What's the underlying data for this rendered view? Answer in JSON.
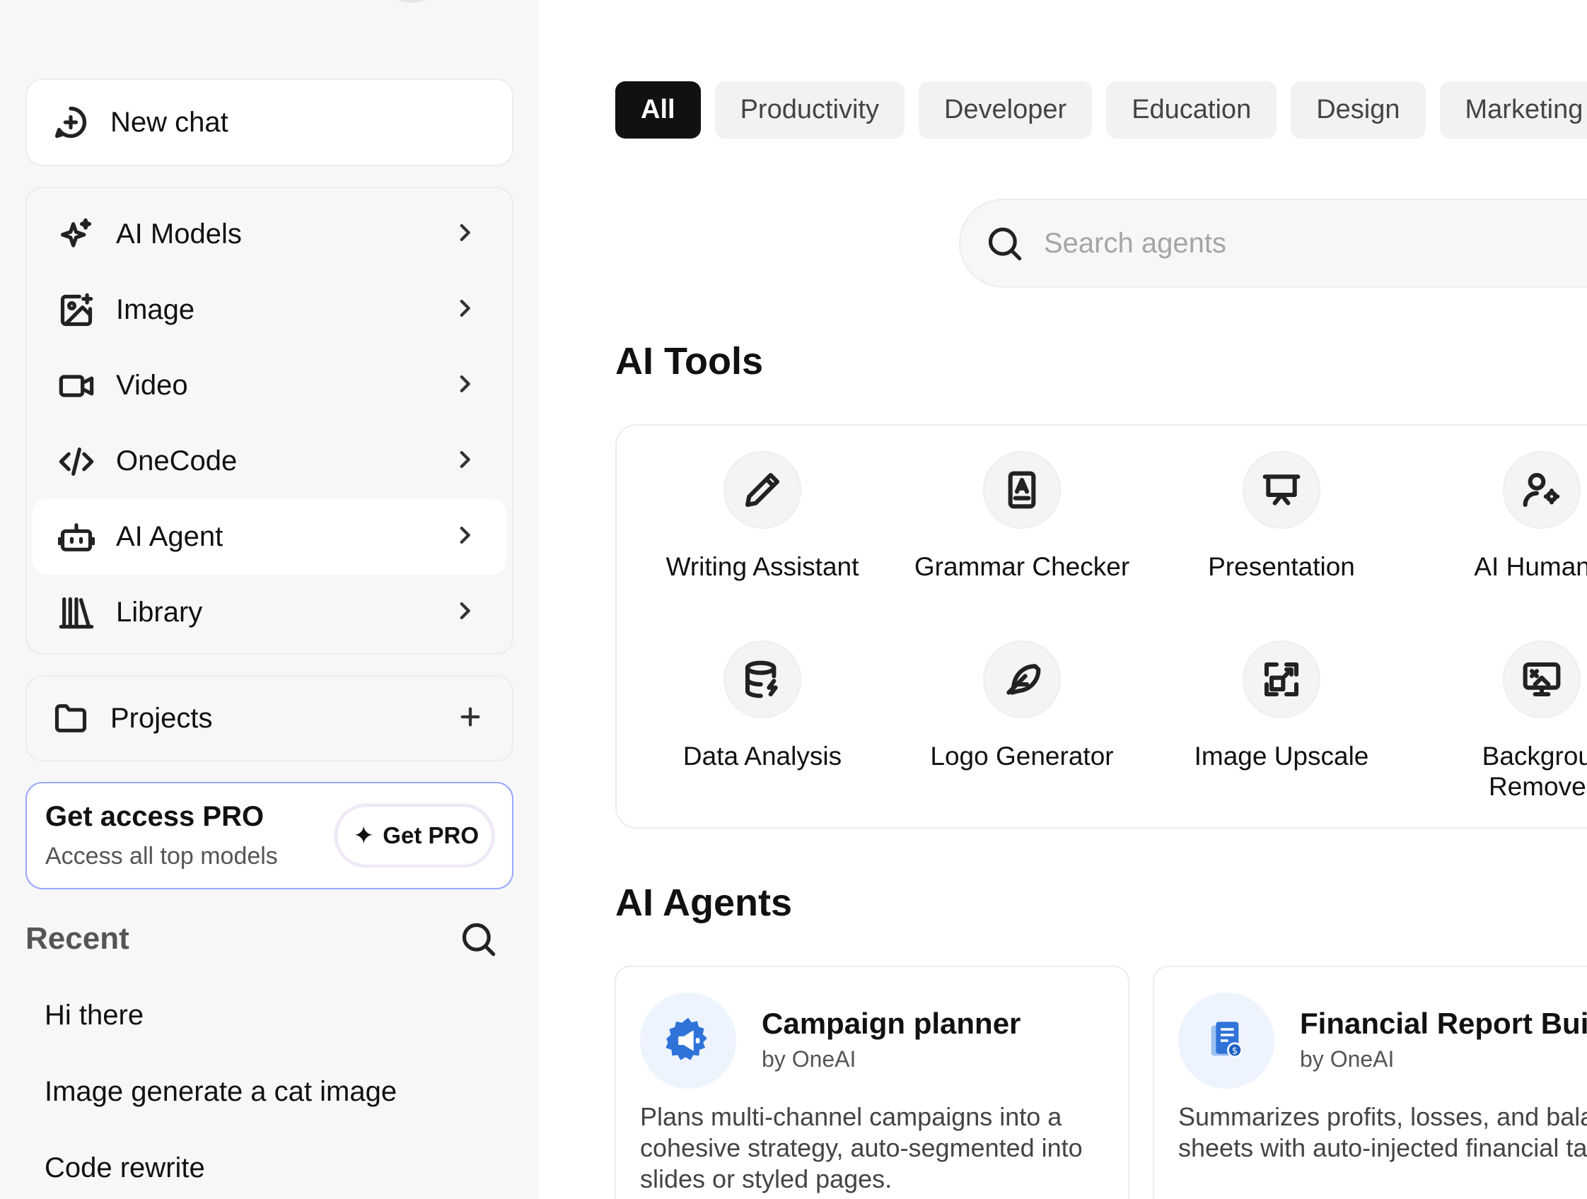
{
  "sidebar": {
    "new_chat": "New chat",
    "nav": [
      {
        "label": "AI Models",
        "icon": "sparkle-icon"
      },
      {
        "label": "Image",
        "icon": "image-icon"
      },
      {
        "label": "Video",
        "icon": "video-icon"
      },
      {
        "label": "OneCode",
        "icon": "code-icon"
      },
      {
        "label": "AI Agent",
        "icon": "robot-icon",
        "active": true
      },
      {
        "label": "Library",
        "icon": "library-icon"
      }
    ],
    "projects": "Projects",
    "pro": {
      "title": "Get access PRO",
      "subtitle": "Access all top models",
      "button": "Get PRO"
    },
    "recent": {
      "title": "Recent",
      "items": [
        "Hi there",
        "Image generate a cat image",
        "Code rewrite"
      ]
    }
  },
  "main": {
    "categories": [
      "All",
      "Productivity",
      "Developer",
      "Education",
      "Design",
      "Marketing"
    ],
    "active_category": "All",
    "search": {
      "placeholder": "Search agents"
    },
    "tools_title": "AI Tools",
    "tools": [
      {
        "label": "Writing Assistant",
        "icon": "pencil-icon"
      },
      {
        "label": "Grammar Checker",
        "icon": "grammar-book-icon"
      },
      {
        "label": "Presentation",
        "icon": "presentation-icon"
      },
      {
        "label": "AI Humaniz",
        "icon": "user-gear-icon"
      },
      {
        "label": "Data Analysis",
        "icon": "database-icon"
      },
      {
        "label": "Logo Generator",
        "icon": "feather-icon"
      },
      {
        "label": "Image Upscale",
        "icon": "upscale-icon"
      },
      {
        "label": "Backgrour\nRemover",
        "icon": "background-remover-icon"
      }
    ],
    "agents_title": "AI Agents",
    "agents": [
      {
        "name": "Campaign planner",
        "by": "by OneAI",
        "description": "Plans multi-channel campaigns into a cohesive strategy, auto-segmented into slides or styled pages.",
        "icon": "megaphone-gear-icon"
      },
      {
        "name": "Financial Report Build",
        "by": "by OneAI",
        "description": "Summarizes profits, losses, and bala sheets with auto-injected financial tables.",
        "icon": "finance-document-icon"
      }
    ]
  },
  "colors": {
    "sidebar_bg": "#f7f7f7",
    "chip_active": "#111111",
    "chip_bg": "#f2f2f2",
    "pro_border": "#9aa8ff",
    "agent_icon_blue": "#2f73d9",
    "agent_icon_bg": "#eef4fd"
  }
}
